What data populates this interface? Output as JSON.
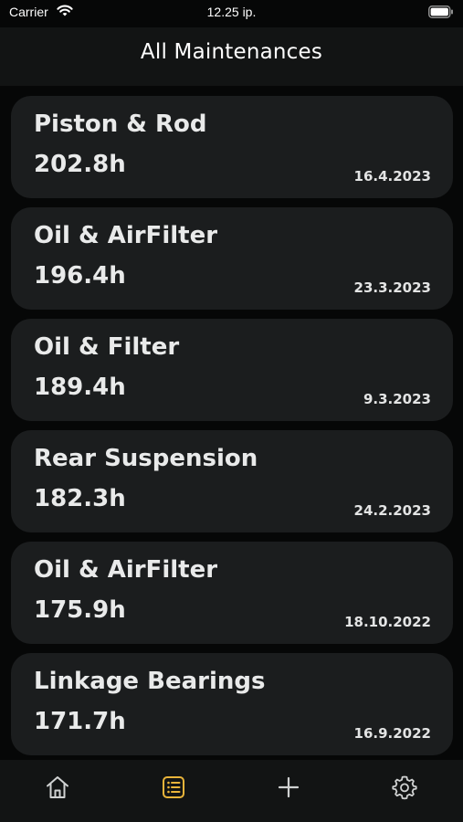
{
  "status_bar": {
    "carrier": "Carrier",
    "time": "12.25 ip."
  },
  "header": {
    "title": "All Maintenances"
  },
  "maintenances": [
    {
      "name": "Piston & Rod",
      "hours": "202.8h",
      "date": "16.4.2023"
    },
    {
      "name": "Oil & AirFilter",
      "hours": "196.4h",
      "date": "23.3.2023"
    },
    {
      "name": "Oil & Filter",
      "hours": "189.4h",
      "date": "9.3.2023"
    },
    {
      "name": "Rear Suspension",
      "hours": "182.3h",
      "date": "24.2.2023"
    },
    {
      "name": "Oil & AirFilter",
      "hours": "175.9h",
      "date": "18.10.2022"
    },
    {
      "name": "Linkage Bearings",
      "hours": "171.7h",
      "date": "16.9.2022"
    }
  ],
  "tab_bar": {
    "tabs": [
      {
        "icon": "home-icon",
        "active": false
      },
      {
        "icon": "list-icon",
        "active": true
      },
      {
        "icon": "plus-icon",
        "active": false
      },
      {
        "icon": "gear-icon",
        "active": false
      }
    ],
    "active_color": "#e9b43a",
    "inactive_color": "#d0d2d2"
  },
  "colors": {
    "background": "#060707",
    "card": "#1b1d1e",
    "header": "#121414"
  }
}
